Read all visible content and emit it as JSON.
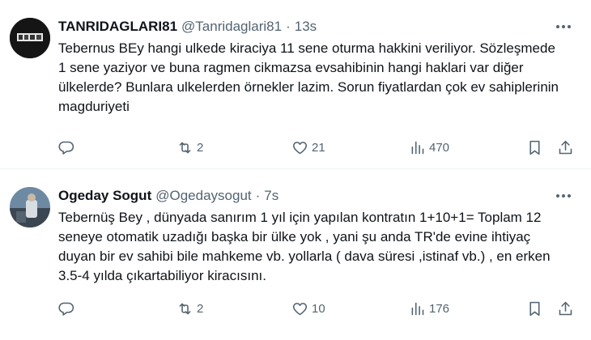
{
  "tweets": [
    {
      "name": "TANRIDAGLARI81",
      "handle": "@Tanridaglari81",
      "time": "13s",
      "text": "Tebernus BEy hangi ulkede kiraciya 11 sene oturma hakkini veriliyor. Sözleşmede 1 sene yaziyor ve buna ragmen cikmazsa evsahibinin hangi haklari var diğer ülkelerde? Bunlara ulkelerden örnekler lazim. Sorun fiyatlardan çok ev sahiplerinin magduriyeti",
      "replies": "",
      "retweets": "2",
      "likes": "21",
      "views": "470"
    },
    {
      "name": "Ogeday Sogut",
      "handle": "@Ogedaysogut",
      "time": "7s",
      "text": "Tebernüş Bey , dünyada sanırım 1 yıl için yapılan kontratın 1+10+1= Toplam 12 seneye otomatik uzadığı başka bir ülke yok , yani şu anda TR'de evine ihtiyaç duyan bir ev sahibi bile mahkeme vb. yollarla ( dava süresi ,istinaf vb.) , en erken 3.5-4 yılda çıkartabiliyor kiracısını.",
      "replies": "",
      "retweets": "2",
      "likes": "10",
      "views": "176"
    }
  ],
  "separator": "·",
  "icons": {
    "more": "more-horizontal-icon",
    "reply": "reply-icon",
    "retweet": "retweet-icon",
    "like": "heart-icon",
    "views": "views-chart-icon",
    "bookmark": "bookmark-icon",
    "share": "share-icon"
  },
  "colors": {
    "text": "#0f1419",
    "secondary": "#536471",
    "divider": "#eff3f4"
  }
}
